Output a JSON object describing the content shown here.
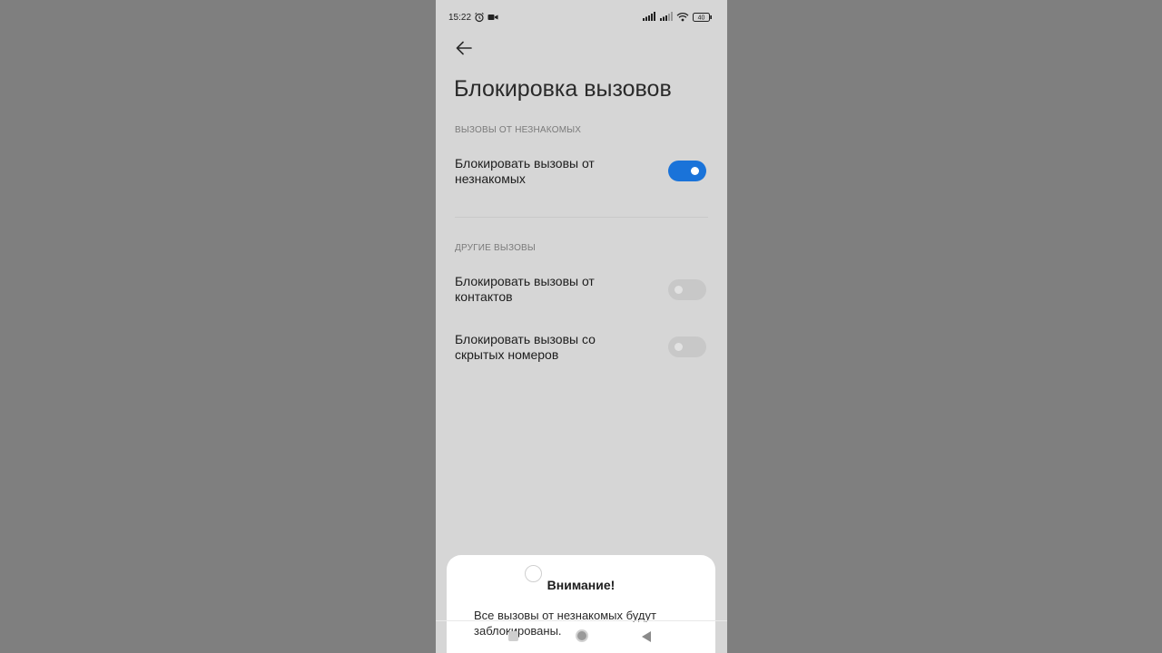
{
  "status_bar": {
    "time": "15:22",
    "battery": "40",
    "icons": [
      "alarm-icon",
      "video-icon",
      "signal-icon",
      "signal-icon",
      "wifi-icon",
      "battery-icon"
    ]
  },
  "header": {
    "back_icon": "arrow-left-icon",
    "title": "Блокировка вызовов"
  },
  "sections": [
    {
      "header": "ВЫЗОВЫ ОТ НЕЗНАКОМЫХ",
      "items": [
        {
          "label": "Блокировать вызовы от незнакомых",
          "enabled": true
        }
      ]
    },
    {
      "header": "ДРУГИЕ ВЫЗОВЫ",
      "items": [
        {
          "label": "Блокировать вызовы от контактов",
          "enabled": false
        },
        {
          "label": "Блокировать вызовы со скрытых номеров",
          "enabled": false
        }
      ]
    }
  ],
  "dialog": {
    "title": "Внимание!",
    "message": "Все вызовы от незнакомых будут заблокированы."
  },
  "colors": {
    "accent": "#1a73d9",
    "screen_background": "#d6d6d6",
    "outer_background": "#7f7f7f"
  }
}
